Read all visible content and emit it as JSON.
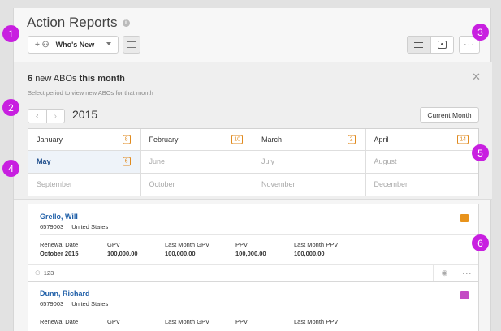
{
  "header": {
    "title": "Action Reports",
    "info_icon": "info-icon",
    "whos_new_label": "Who's New",
    "more_label": "···"
  },
  "panel": {
    "count": "6",
    "title_mid": "new ABOs",
    "title_end": "this month",
    "subtitle": "Select period to view new ABOs for that month",
    "close": "✕",
    "year": "2015",
    "current_month_label": "Current Month",
    "prev": "‹",
    "next": "›"
  },
  "months": [
    {
      "name": "January",
      "badge": "8"
    },
    {
      "name": "February",
      "badge": "10"
    },
    {
      "name": "March",
      "badge": "2"
    },
    {
      "name": "April",
      "badge": "14"
    },
    {
      "name": "May",
      "badge": "6"
    },
    {
      "name": "June",
      "badge": ""
    },
    {
      "name": "July",
      "badge": ""
    },
    {
      "name": "August",
      "badge": ""
    },
    {
      "name": "September",
      "badge": ""
    },
    {
      "name": "October",
      "badge": ""
    },
    {
      "name": "November",
      "badge": ""
    },
    {
      "name": "December",
      "badge": ""
    }
  ],
  "cards": [
    {
      "name": "Grello, Will",
      "id": "6579003",
      "country": "United States",
      "status_color": "#e8931c",
      "metrics": [
        {
          "label": "Renewal Date",
          "value": "October 2015"
        },
        {
          "label": "GPV",
          "value": "100,000.00"
        },
        {
          "label": "Last Month GPV",
          "value": "100,000.00"
        },
        {
          "label": "PPV",
          "value": "100,000.00"
        },
        {
          "label": "Last Month PPV",
          "value": "100,000.00"
        }
      ],
      "count": "123"
    },
    {
      "name": "Dunn, Richard",
      "id": "6579003",
      "country": "United States",
      "status_color": "#c44bc4",
      "metrics": [
        {
          "label": "Renewal Date",
          "value": ""
        },
        {
          "label": "GPV",
          "value": ""
        },
        {
          "label": "Last Month GPV",
          "value": ""
        },
        {
          "label": "PPV",
          "value": ""
        },
        {
          "label": "Last Month PPV",
          "value": ""
        }
      ]
    }
  ],
  "callouts": [
    "1",
    "2",
    "3",
    "4",
    "5",
    "6"
  ],
  "colors": {
    "accent": "#c81fe0",
    "link": "#1f5fa8",
    "badge": "#e08a1e"
  }
}
